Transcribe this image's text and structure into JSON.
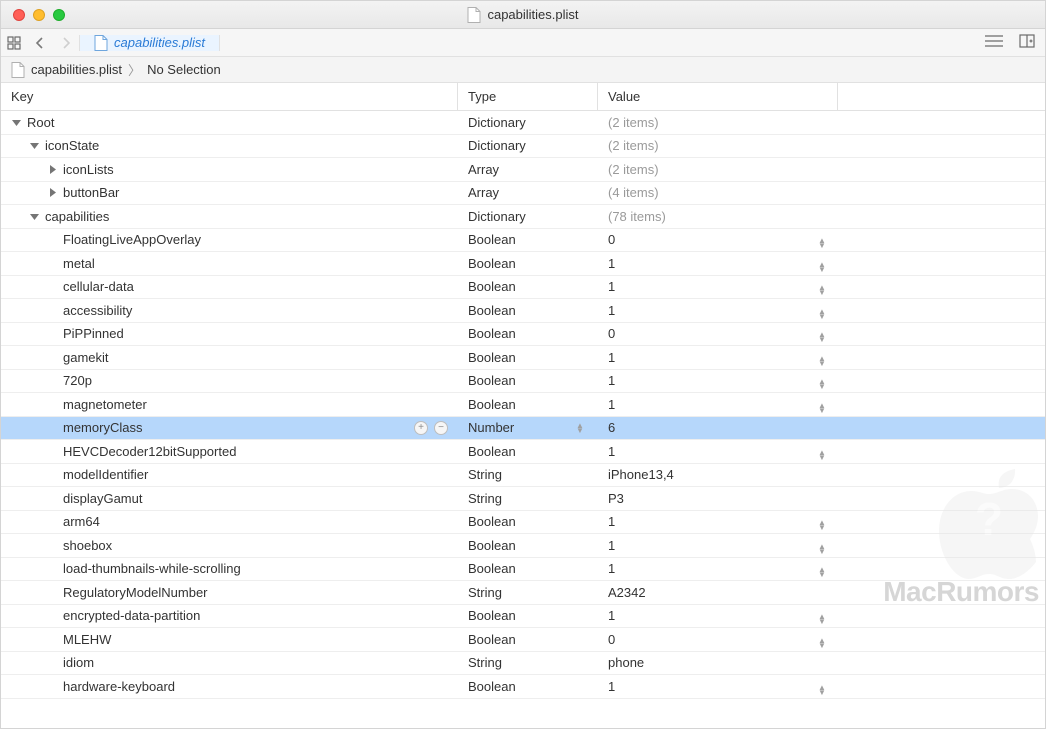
{
  "window": {
    "title": "capabilities.plist"
  },
  "tabs": {
    "active": "capabilities.plist"
  },
  "breadcrumb": {
    "root": "capabilities.plist",
    "leaf": "No Selection"
  },
  "columns": {
    "key": "Key",
    "type": "Type",
    "value": "Value"
  },
  "rows": [
    {
      "indent": 0,
      "arrow": "down",
      "key": "Root",
      "type": "Dictionary",
      "value": "(2 items)",
      "muted": true,
      "stepper": false
    },
    {
      "indent": 1,
      "arrow": "down",
      "key": "iconState",
      "type": "Dictionary",
      "value": "(2 items)",
      "muted": true,
      "stepper": false
    },
    {
      "indent": 2,
      "arrow": "right",
      "key": "iconLists",
      "type": "Array",
      "value": "(2 items)",
      "muted": true,
      "stepper": false
    },
    {
      "indent": 2,
      "arrow": "right",
      "key": "buttonBar",
      "type": "Array",
      "value": "(4 items)",
      "muted": true,
      "stepper": false
    },
    {
      "indent": 1,
      "arrow": "down",
      "key": "capabilities",
      "type": "Dictionary",
      "value": "(78 items)",
      "muted": true,
      "stepper": false
    },
    {
      "indent": 2,
      "arrow": "",
      "key": "FloatingLiveAppOverlay",
      "type": "Boolean",
      "value": "0",
      "stepper": true
    },
    {
      "indent": 2,
      "arrow": "",
      "key": "metal",
      "type": "Boolean",
      "value": "1",
      "stepper": true
    },
    {
      "indent": 2,
      "arrow": "",
      "key": "cellular-data",
      "type": "Boolean",
      "value": "1",
      "stepper": true
    },
    {
      "indent": 2,
      "arrow": "",
      "key": "accessibility",
      "type": "Boolean",
      "value": "1",
      "stepper": true
    },
    {
      "indent": 2,
      "arrow": "",
      "key": "PiPPinned",
      "type": "Boolean",
      "value": "0",
      "stepper": true
    },
    {
      "indent": 2,
      "arrow": "",
      "key": "gamekit",
      "type": "Boolean",
      "value": "1",
      "stepper": true
    },
    {
      "indent": 2,
      "arrow": "",
      "key": "720p",
      "type": "Boolean",
      "value": "1",
      "stepper": true
    },
    {
      "indent": 2,
      "arrow": "",
      "key": "magnetometer",
      "type": "Boolean",
      "value": "1",
      "stepper": true
    },
    {
      "indent": 2,
      "arrow": "",
      "key": "memoryClass",
      "type": "Number",
      "value": "6",
      "selected": true,
      "rowicons": true,
      "typeStepper": true
    },
    {
      "indent": 2,
      "arrow": "",
      "key": "HEVCDecoder12bitSupported",
      "type": "Boolean",
      "value": "1",
      "stepper": true
    },
    {
      "indent": 2,
      "arrow": "",
      "key": "modelIdentifier",
      "type": "String",
      "value": "iPhone13,4"
    },
    {
      "indent": 2,
      "arrow": "",
      "key": "displayGamut",
      "type": "String",
      "value": "P3"
    },
    {
      "indent": 2,
      "arrow": "",
      "key": "arm64",
      "type": "Boolean",
      "value": "1",
      "stepper": true
    },
    {
      "indent": 2,
      "arrow": "",
      "key": "shoebox",
      "type": "Boolean",
      "value": "1",
      "stepper": true
    },
    {
      "indent": 2,
      "arrow": "",
      "key": "load-thumbnails-while-scrolling",
      "type": "Boolean",
      "value": "1",
      "stepper": true
    },
    {
      "indent": 2,
      "arrow": "",
      "key": "RegulatoryModelNumber",
      "type": "String",
      "value": "A2342"
    },
    {
      "indent": 2,
      "arrow": "",
      "key": "encrypted-data-partition",
      "type": "Boolean",
      "value": "1",
      "stepper": true
    },
    {
      "indent": 2,
      "arrow": "",
      "key": "MLEHW",
      "type": "Boolean",
      "value": "0",
      "stepper": true
    },
    {
      "indent": 2,
      "arrow": "",
      "key": "idiom",
      "type": "String",
      "value": "phone"
    },
    {
      "indent": 2,
      "arrow": "",
      "key": "hardware-keyboard",
      "type": "Boolean",
      "value": "1",
      "stepper": true
    }
  ],
  "watermark": "MacRumors"
}
